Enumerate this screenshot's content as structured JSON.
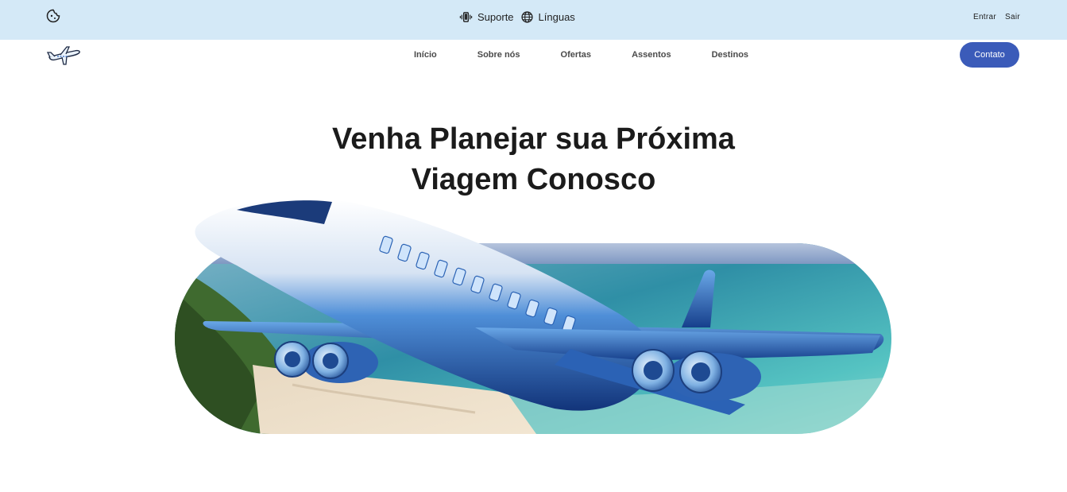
{
  "topbar": {
    "brand_icon": "cookie-icon",
    "support_icon": "vibrating-phone-icon",
    "support_label": "Suporte",
    "languages_icon": "globe-icon",
    "languages_label": "Línguas",
    "login_label": "Entrar",
    "logout_label": "Sair",
    "background": "#d4e9f7"
  },
  "nav": {
    "logo_icon": "airplane-logo-icon",
    "links": [
      "Início",
      "Sobre nós",
      "Ofertas",
      "Assentos",
      "Destinos"
    ],
    "contact_label": "Contato",
    "accent": "#3b5bb9"
  },
  "hero": {
    "title_line1": "Venha Planejar sua Próxima",
    "title_line2": "Viagem Conosco",
    "image": "airplane-over-beach-illustration"
  }
}
